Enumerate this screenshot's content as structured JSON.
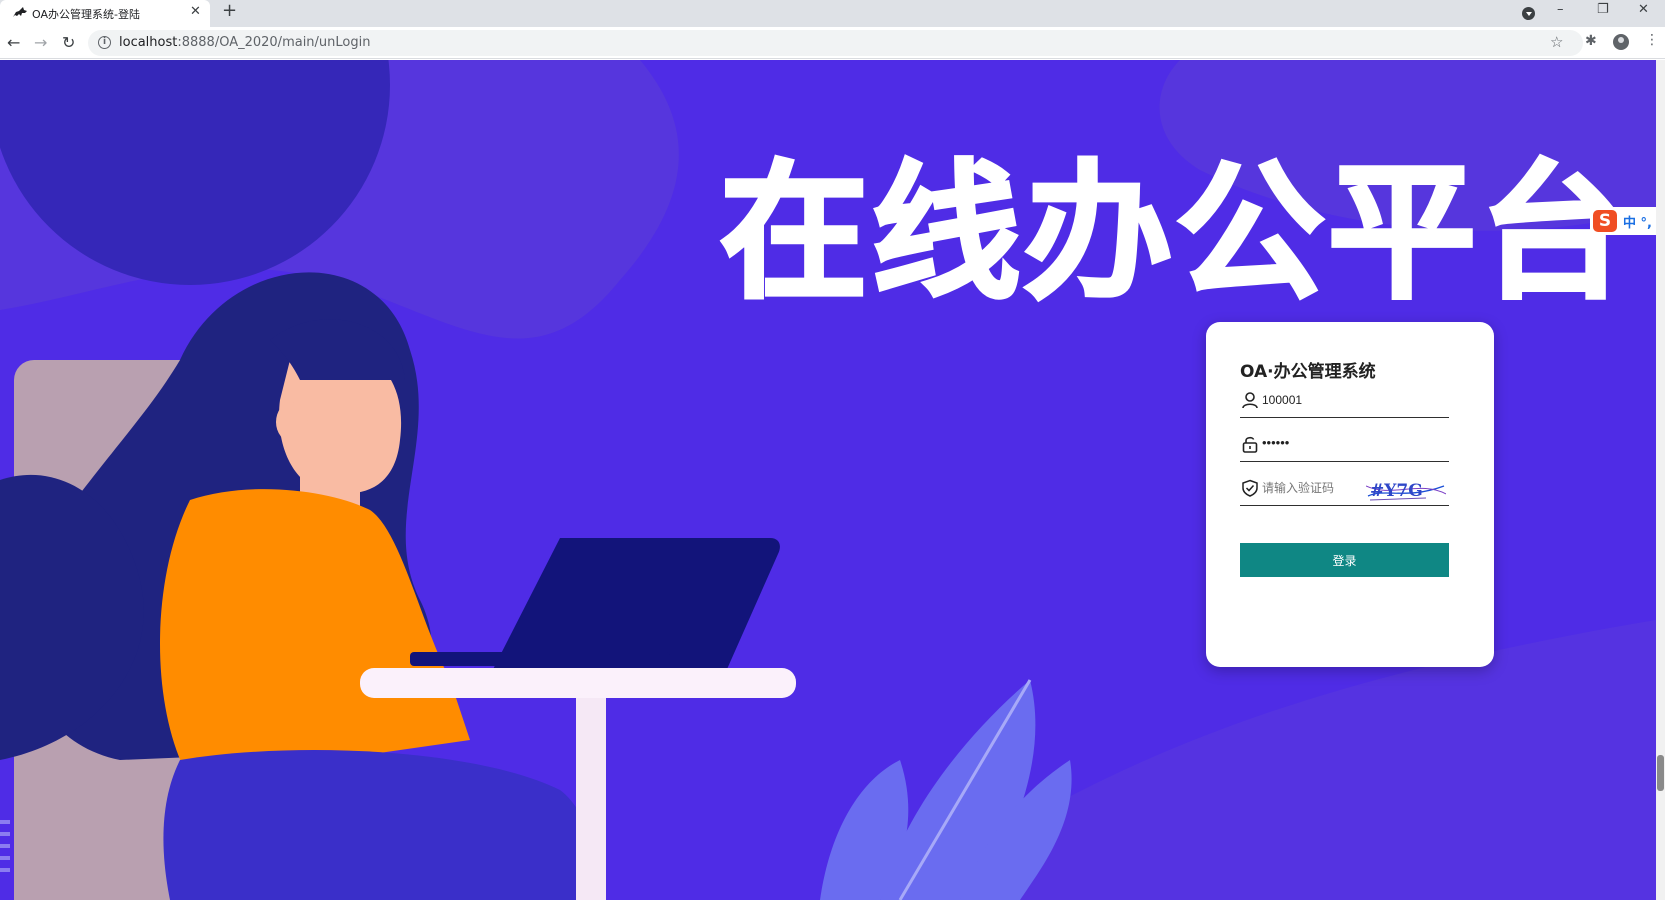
{
  "browser": {
    "tab_title": "OA办公管理系统-登陆",
    "tab_close": "✕",
    "new_tab": "+",
    "url_host": "localhost",
    "url_rest": ":8888/OA_2020/main/unLogin",
    "controls": {
      "minimize": "–",
      "restore": "❐",
      "close": "✕"
    }
  },
  "page": {
    "headline": "在线办公平台",
    "ime": {
      "logo": "S",
      "mode": "中 °,"
    },
    "login": {
      "title": "OA·办公管理系统",
      "username_value": "100001",
      "password_value": "••••••",
      "captcha_placeholder": "请输入验证码",
      "captcha_text": "#Y7G",
      "submit_label": "登录"
    }
  },
  "colors": {
    "background": "#4f2ce6",
    "button": "#0f8784",
    "shirt": "#ff8c00"
  }
}
